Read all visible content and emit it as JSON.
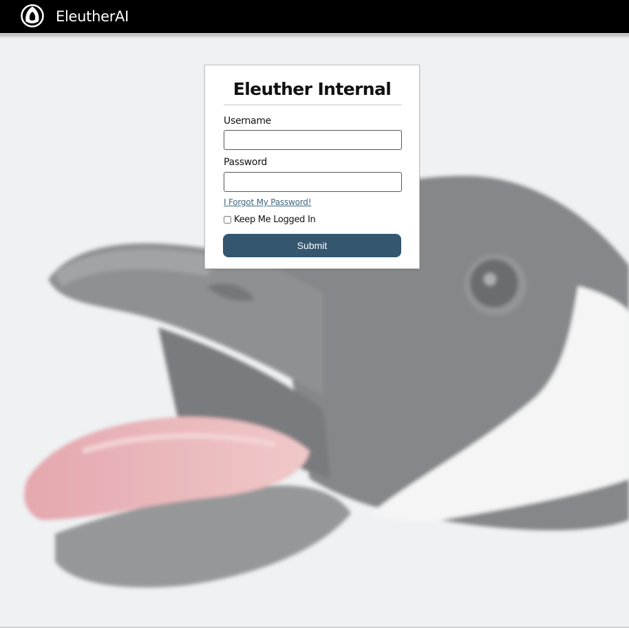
{
  "header": {
    "brand": "EleutherAI",
    "logo_icon": "eleuther-logo-icon"
  },
  "background": {
    "image": "canada-goose-photo",
    "description_colors": {
      "sky": "#eef0f2",
      "head": "#7c7e80",
      "cheek": "#f4f4f4",
      "tongue": "#e8b0b6"
    }
  },
  "login": {
    "title": "Eleuther Internal",
    "username_label": "Username",
    "username_value": "",
    "password_label": "Password",
    "password_value": "",
    "forgot_link": "I Forgot My Password!",
    "remember_label": "Keep Me Logged In",
    "remember_checked": false,
    "submit_label": "Submit"
  },
  "colors": {
    "topbar": "#000000",
    "button": "#34566f",
    "link": "#3e6680"
  }
}
